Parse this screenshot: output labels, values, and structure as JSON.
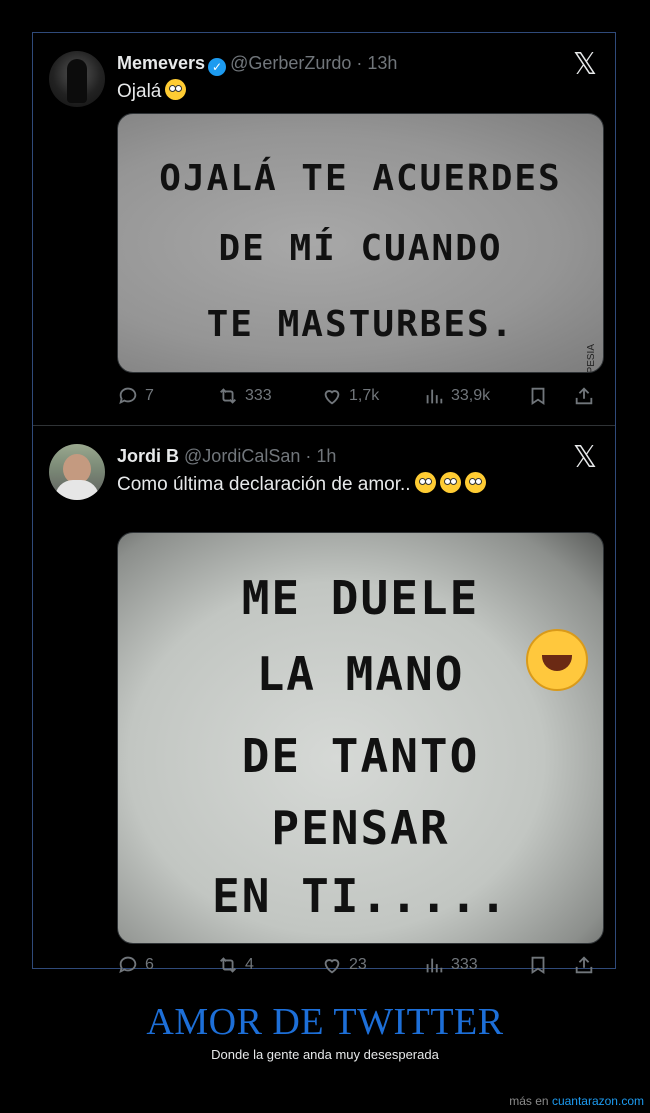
{
  "tweets": [
    {
      "name": "Memevers",
      "handle": "@GerberZurdo",
      "time": "· 13h",
      "text": "Ojalá",
      "image_lines": [
        "OJALÁ TE ACUERDES",
        "DE MÍ CUANDO",
        "TE MASTURBES."
      ],
      "image_signature": "ADEPESIA",
      "stats": {
        "replies": "7",
        "reposts": "333",
        "likes": "1,7k",
        "views": "33,9k"
      }
    },
    {
      "name": "Jordi B",
      "handle": "@JordiCalSan",
      "time": "· 1h",
      "text": "Como última declaración de amor..",
      "image_lines": [
        "ME DUELE",
        "LA MANO",
        "DE TANTO",
        "PENSAR",
        "EN TI....."
      ],
      "stats": {
        "replies": "6",
        "reposts": "4",
        "likes": "23",
        "views": "333"
      }
    }
  ],
  "footer": {
    "title": "AMOR DE TWITTER",
    "subtitle": "Donde la gente anda muy desesperada",
    "credit_prefix": "más en",
    "credit_site": "cuantarazon.com"
  },
  "icons": {
    "x_logo": "x-logo-icon",
    "verified": "verified-badge-icon",
    "reply": "reply-icon",
    "repost": "repost-icon",
    "like": "like-icon",
    "views": "views-icon",
    "bookmark": "bookmark-icon",
    "share": "share-icon"
  },
  "colors": {
    "accent": "#1d9bf0",
    "title": "#1d6fd8",
    "frame": "#2f4a7a"
  }
}
